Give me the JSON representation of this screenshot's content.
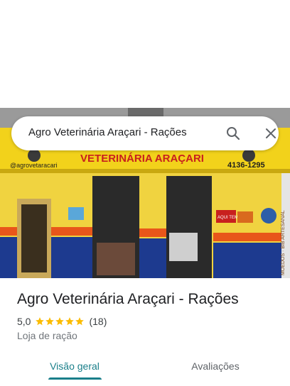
{
  "search": {
    "query": "Agro Veterinária Araçari - Rações",
    "search_icon": "search-icon",
    "close_icon": "close-icon"
  },
  "photo": {
    "sign_title": "VETERINÁRIA ARAÇARI",
    "sign_handle": "@agrovetaracari",
    "sign_phone": "4136-1295",
    "poster_text": "AQUI TEM",
    "side_text": "MOEDOS · BIB ARTESANAL"
  },
  "place": {
    "title": "Agro Veterinária Araçari - Rações",
    "rating": "5,0",
    "stars": 5,
    "review_count": "(18)",
    "category": "Loja de ração"
  },
  "tabs": [
    {
      "label": "Visão geral",
      "active": true
    },
    {
      "label": "Avaliações",
      "active": false
    }
  ],
  "colors": {
    "accent": "#1a7f8a",
    "star": "#fbbc04",
    "sign_yellow": "#f2d21b",
    "sign_red": "#c8201e",
    "tile_blue": "#1d3a8f",
    "stripe_orange": "#e8561a"
  }
}
